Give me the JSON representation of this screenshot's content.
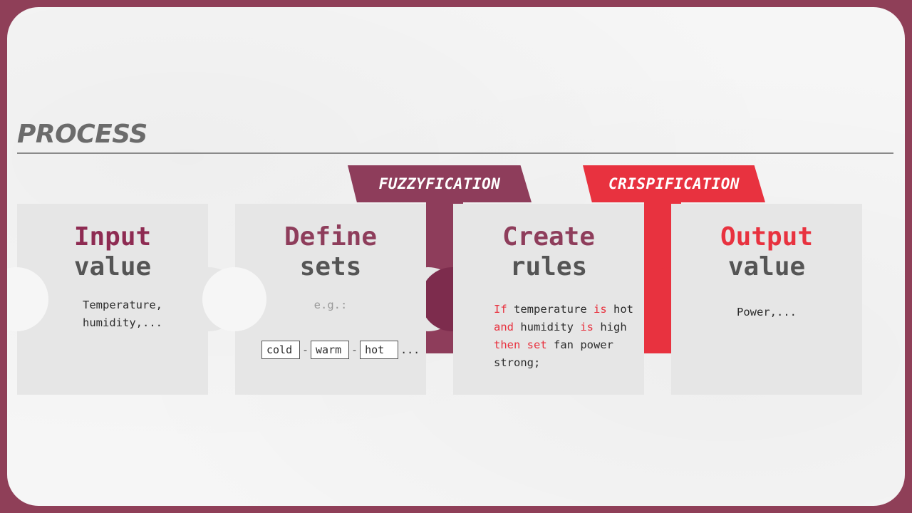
{
  "title": "PROCESS",
  "tags": {
    "fuzzy": "FUZZYFICATION",
    "crisp": "CRISPIFICATION"
  },
  "steps": [
    {
      "title_line1": "Input",
      "title_line2": "value",
      "text_lines": [
        "Temperature,",
        "humidity,..."
      ]
    },
    {
      "title_line1": "Define",
      "title_line2": "sets",
      "text": "e.g.:",
      "sets": [
        "cold",
        "warm",
        "hot"
      ],
      "sets_more": "...",
      "separator": "-"
    },
    {
      "title_line1": "Create",
      "title_line2": "rules",
      "rule": {
        "kw_if": "If",
        "p1": " temperature ",
        "kw_is1": "is",
        "p2": " hot",
        "kw_and": "and",
        "p3": " humidity ",
        "kw_is2": "is",
        "p4": " high",
        "kw_then": "then set",
        "p5": " fan power",
        "p6": "strong;"
      }
    },
    {
      "title_line1": "Output",
      "title_line2": "value",
      "text": "Power,..."
    }
  ],
  "colors": {
    "maroon": "#8e2b52",
    "mauve": "#8e3d5b",
    "red": "#e8323f",
    "frame": "#8f3f58"
  }
}
